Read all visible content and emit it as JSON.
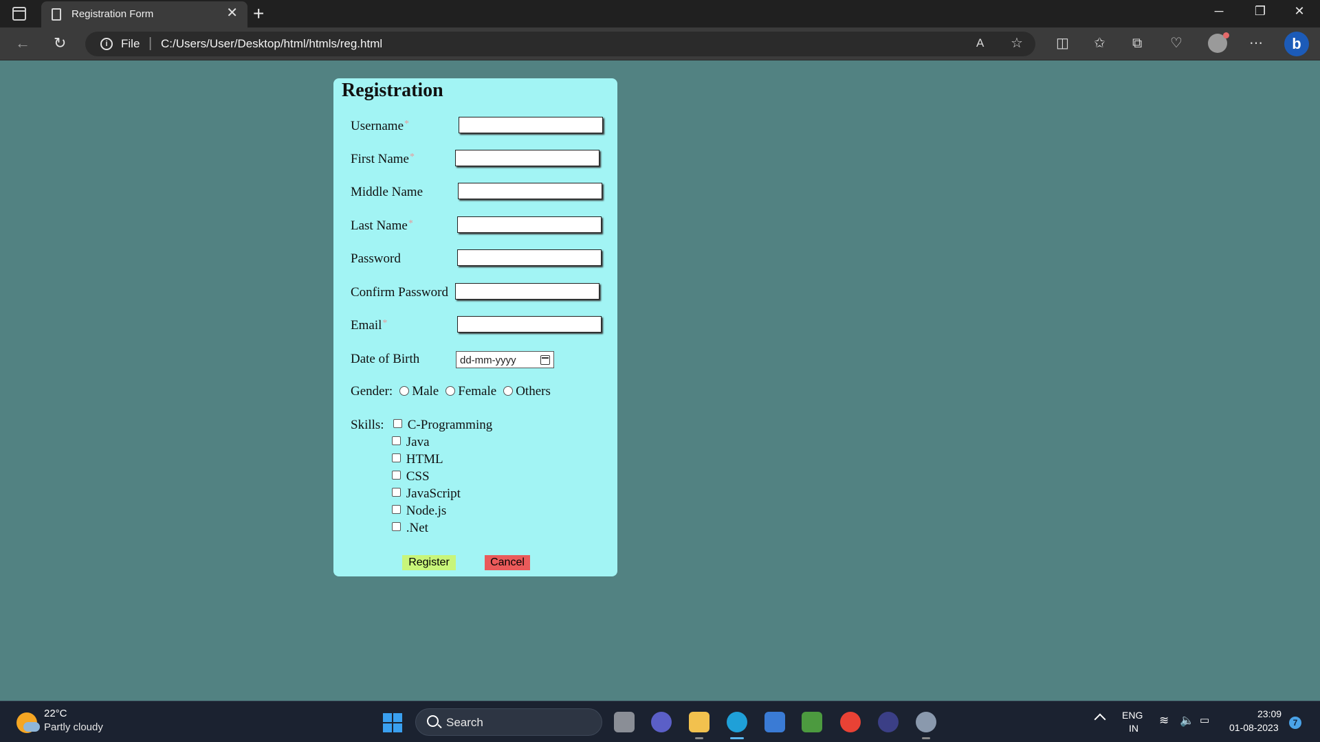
{
  "browser": {
    "tab_title": "Registration Form",
    "tab_close": "✕",
    "new_tab": "+",
    "scheme_label": "File",
    "url": "C:/Users/User/Desktop/html/htmls/reg.html",
    "window_controls": {
      "minimize": "─",
      "restore": "❐",
      "close": "✕"
    },
    "toolbar_icons": [
      "read-aloud-icon",
      "favorite-star-icon",
      "split-screen-icon",
      "favorites-icon",
      "collections-icon",
      "browser-essentials-icon",
      "profile-icon",
      "more-icon",
      "bing-icon"
    ]
  },
  "form": {
    "title": "Registration",
    "fields": [
      {
        "label": "Username",
        "required": true
      },
      {
        "label": "First Name",
        "required": true
      },
      {
        "label": "Middle Name",
        "required": false
      },
      {
        "label": "Last Name",
        "required": true
      },
      {
        "label": "Password",
        "required": false
      },
      {
        "label": "Confirm Password",
        "required": false
      },
      {
        "label": "Email",
        "required": true
      },
      {
        "label": "Date of Birth",
        "required": false
      }
    ],
    "required_marker": "*",
    "dob_placeholder": "dd-mm-yyyy",
    "gender_label": "Gender:",
    "gender_options": [
      "Male",
      "Female",
      "Others"
    ],
    "skills_label": "Skills:",
    "skills": [
      "C-Programming",
      "Java",
      "HTML",
      "CSS",
      "JavaScript",
      "Node.js",
      ".Net"
    ],
    "register_label": "Register",
    "cancel_label": "Cancel",
    "colors": {
      "card_bg": "#a2f4f4",
      "page_bg": "#528282",
      "register_bg": "#c8f57a",
      "cancel_bg": "#ea5a5a"
    }
  },
  "taskbar": {
    "temperature": "22°C",
    "condition": "Partly cloudy",
    "search_label": "Search",
    "language_top": "ENG",
    "language_bottom": "IN",
    "time": "23:09",
    "date": "01-08-2023",
    "notification_count": "7",
    "apps": [
      "task-view-icon",
      "teams-icon",
      "file-explorer-icon",
      "edge-icon",
      "store-icon",
      "image-app-icon",
      "chrome-icon",
      "eclipse-icon",
      "settings-icon"
    ]
  }
}
